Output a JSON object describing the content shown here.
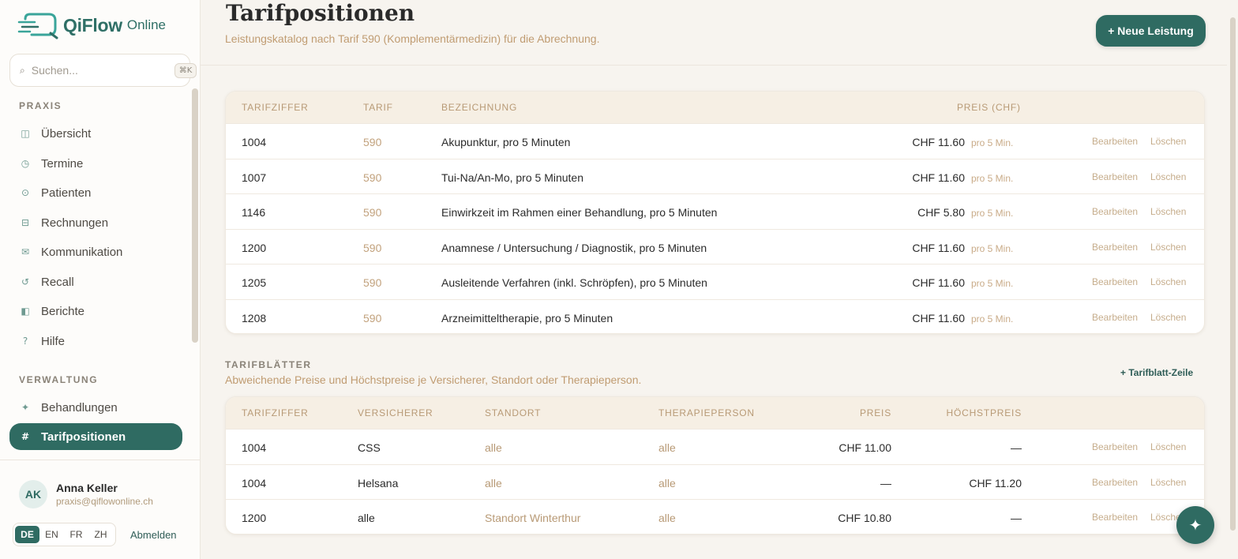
{
  "app": {
    "name": "QiFlow",
    "name_suffix": "Online"
  },
  "search": {
    "placeholder": "Suchen...",
    "shortcut": "⌘K"
  },
  "sidebar": {
    "sections": [
      {
        "title": "PRAXIS",
        "items": [
          {
            "label": "Übersicht",
            "icon": "overview-icon"
          },
          {
            "label": "Termine",
            "icon": "clock-icon"
          },
          {
            "label": "Patienten",
            "icon": "patients-icon"
          },
          {
            "label": "Rechnungen",
            "icon": "invoice-icon"
          },
          {
            "label": "Kommunikation",
            "icon": "mail-icon"
          },
          {
            "label": "Recall",
            "icon": "recall-icon"
          },
          {
            "label": "Berichte",
            "icon": "reports-icon"
          },
          {
            "label": "Hilfe",
            "icon": "help-icon"
          }
        ]
      },
      {
        "title": "VERWALTUNG",
        "items": [
          {
            "label": "Behandlungen",
            "icon": "sparkle-icon"
          },
          {
            "label": "Tarifpositionen",
            "icon": "hash-icon",
            "active": true
          }
        ]
      }
    ]
  },
  "user": {
    "initials": "AK",
    "name": "Anna Keller",
    "email": "praxis@qiflowonline.ch",
    "logout": "Abmelden"
  },
  "languages": {
    "items": [
      "DE",
      "EN",
      "FR",
      "ZH"
    ],
    "active": "DE"
  },
  "page": {
    "title": "Tarifpositionen",
    "subtitle": "Leistungskatalog nach Tarif 590 (Komplementärmedizin) für die Abrechnung.",
    "new_button": "+ Neue Leistung"
  },
  "positions_table": {
    "headers": {
      "code": "TARIFZIFFER",
      "tarif": "TARIF",
      "desc": "BEZEICHNUNG",
      "price": "PREIS (CHF)"
    },
    "rows": [
      {
        "code": "1004",
        "tarif": "590",
        "desc": "Akupunktur, pro 5 Minuten",
        "price": "CHF 11.60",
        "unit": "pro 5 Min."
      },
      {
        "code": "1007",
        "tarif": "590",
        "desc": "Tui-Na/An-Mo, pro 5 Minuten",
        "price": "CHF 11.60",
        "unit": "pro 5 Min."
      },
      {
        "code": "1146",
        "tarif": "590",
        "desc": "Einwirkzeit im Rahmen einer Behandlung, pro 5 Minuten",
        "price": "CHF 5.80",
        "unit": "pro 5 Min."
      },
      {
        "code": "1200",
        "tarif": "590",
        "desc": "Anamnese / Untersuchung / Diagnostik, pro 5 Minuten",
        "price": "CHF 11.60",
        "unit": "pro 5 Min."
      },
      {
        "code": "1205",
        "tarif": "590",
        "desc": "Ausleitende Verfahren (inkl. Schröpfen), pro 5 Minuten",
        "price": "CHF 11.60",
        "unit": "pro 5 Min."
      },
      {
        "code": "1208",
        "tarif": "590",
        "desc": "Arzneimitteltherapie, pro 5 Minuten",
        "price": "CHF 11.60",
        "unit": "pro 5 Min."
      }
    ]
  },
  "actions": {
    "edit": "Bearbeiten",
    "delete": "Löschen"
  },
  "tarifblaetter": {
    "title": "TARIFBLÄTTER",
    "subtitle": "Abweichende Preise und Höchstpreise je Versicherer, Standort oder Therapieperson.",
    "add_button": "+ Tarifblatt-Zeile",
    "headers": {
      "code": "TARIFZIFFER",
      "insurer": "VERSICHERER",
      "location": "STANDORT",
      "therapist": "THERAPIEPERSON",
      "price": "PREIS",
      "max_price": "HÖCHSTPREIS"
    },
    "rows": [
      {
        "code": "1004",
        "insurer": "CSS",
        "location": "alle",
        "therapist": "alle",
        "price": "CHF 11.00",
        "max_price": "—"
      },
      {
        "code": "1004",
        "insurer": "Helsana",
        "location": "alle",
        "therapist": "alle",
        "price": "—",
        "max_price": "CHF 11.20"
      },
      {
        "code": "1200",
        "insurer": "alle",
        "location": "Standort Winterthur",
        "therapist": "alle",
        "price": "CHF 10.80",
        "max_price": "—"
      }
    ]
  },
  "fab_icon": "sparkle-icon",
  "colors": {
    "accent": "#2f6b62",
    "muted_text": "#c09c72",
    "header_bg": "#f6efe4"
  }
}
